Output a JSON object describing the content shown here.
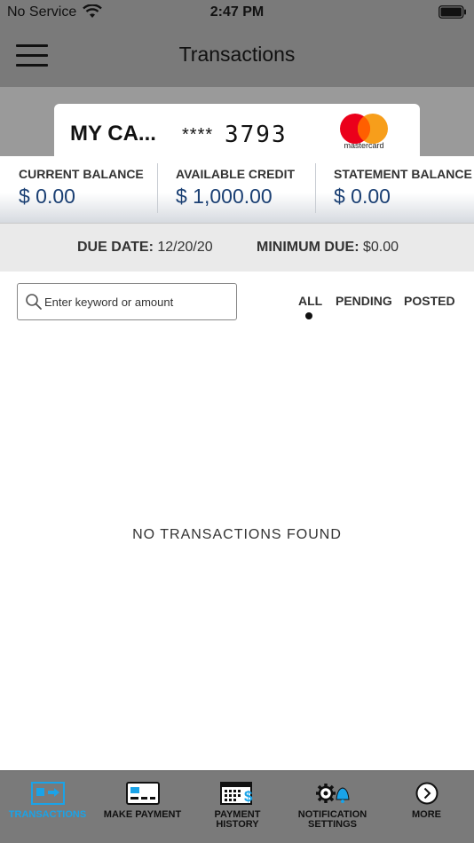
{
  "status_bar": {
    "carrier": "No Service",
    "time": "2:47 PM"
  },
  "header": {
    "title": "Transactions"
  },
  "card": {
    "name": "MY CA...",
    "mask": "****",
    "last4": "3793",
    "brand": "mastercard"
  },
  "balances": [
    {
      "label": "CURRENT BALANCE",
      "value": "$ 0.00"
    },
    {
      "label": "AVAILABLE CREDIT",
      "value": "$ 1,000.00"
    },
    {
      "label": "STATEMENT BALANCE",
      "value": "$ 0.00"
    }
  ],
  "due": {
    "due_date_label": "DUE DATE:",
    "due_date_value": "12/20/20",
    "min_due_label": "MINIMUM DUE:",
    "min_due_value": "$0.00"
  },
  "search": {
    "placeholder": "Enter keyword or amount"
  },
  "filters": [
    {
      "label": "ALL",
      "active": true
    },
    {
      "label": "PENDING",
      "active": false
    },
    {
      "label": "POSTED",
      "active": false
    }
  ],
  "empty_message": "NO TRANSACTIONS FOUND",
  "tabbar": [
    {
      "label_line1": "TRANSACTIONS",
      "label_line2": "",
      "icon": "transactions-icon",
      "active": true
    },
    {
      "label_line1": "MAKE PAYMENT",
      "label_line2": "",
      "icon": "card-payment-icon",
      "active": false
    },
    {
      "label_line1": "PAYMENT",
      "label_line2": "HISTORY",
      "icon": "calendar-dollar-icon",
      "active": false
    },
    {
      "label_line1": "NOTIFICATION",
      "label_line2": "SETTINGS",
      "icon": "gear-bell-icon",
      "active": false
    },
    {
      "label_line1": "MORE",
      "label_line2": "",
      "icon": "chevron-right-circle-icon",
      "active": false
    }
  ],
  "colors": {
    "accent": "#1aa3e8",
    "balance_value": "#1a3f73",
    "bar_gray": "#7a7a7a",
    "mc_red": "#eb001b",
    "mc_orange": "#f79e1b"
  }
}
